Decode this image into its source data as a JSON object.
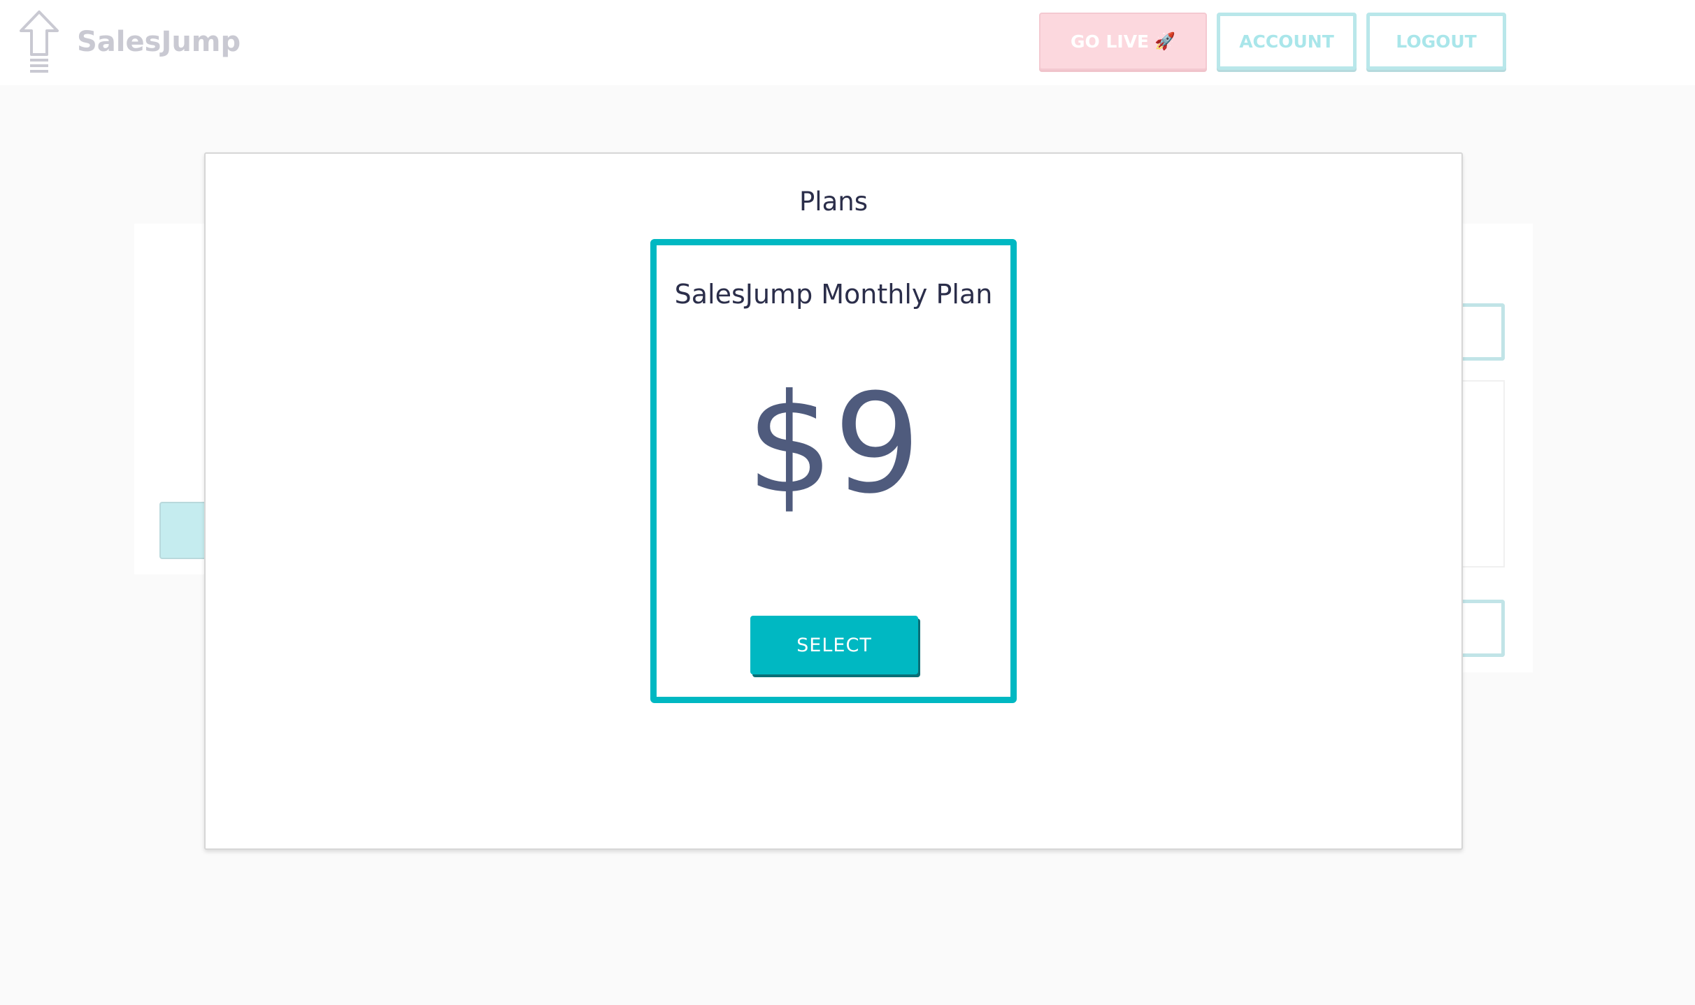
{
  "navbar": {
    "brand": "SalesJump",
    "go_live_label": "GO LIVE",
    "go_live_icon": "rocket-icon",
    "account_label": "ACCOUNT",
    "logout_label": "LOGOUT",
    "logo_icon": "up-arrow-logo-icon"
  },
  "modal": {
    "title": "Plans",
    "plan": {
      "name": "SalesJump Monthly Plan",
      "price": "$9",
      "select_label": "SELECT"
    }
  },
  "colors": {
    "accent": "#00b8c2",
    "text_dark": "#2b2e4a",
    "price": "#4f5b7d",
    "go_live_pink": "#fcd8de"
  }
}
